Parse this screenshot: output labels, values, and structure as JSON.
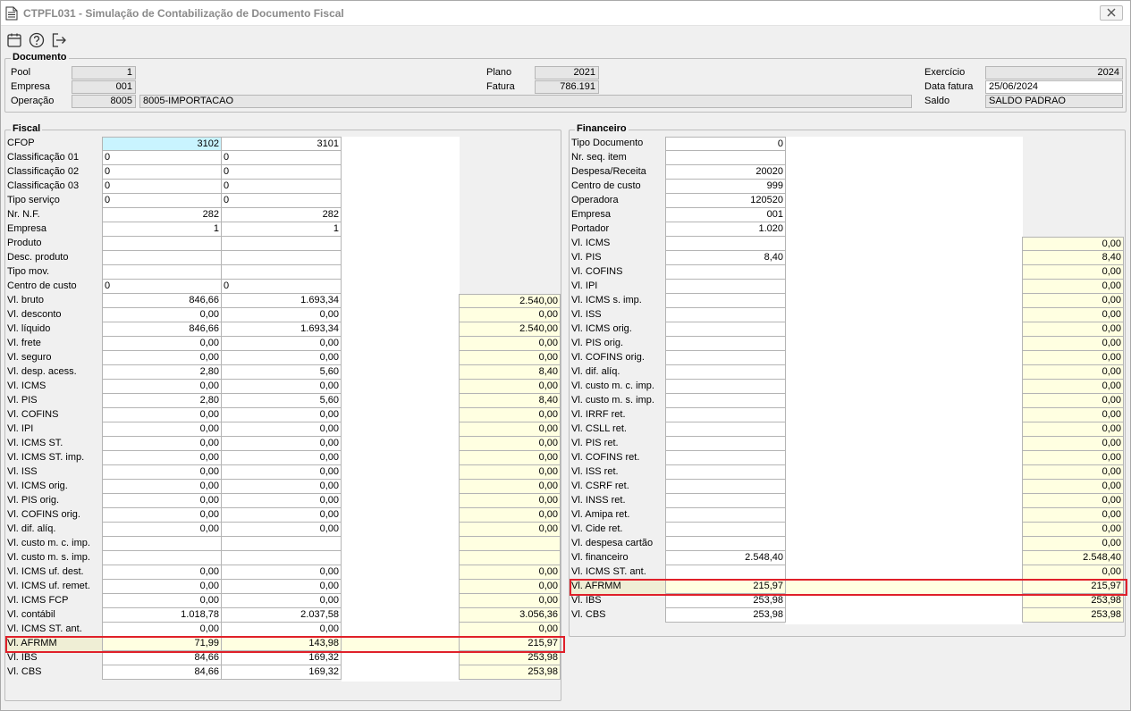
{
  "window": {
    "title": "CTPFL031 - Simulação de Contabilização de Documento Fiscal",
    "icons": {
      "app": "document-icon",
      "close": "close-icon"
    }
  },
  "toolbar": {
    "icons": [
      "calendar-icon",
      "help-icon",
      "exit-icon"
    ]
  },
  "documento": {
    "title": "Documento",
    "pool_label": "Pool",
    "pool": "1",
    "empresa_label": "Empresa",
    "empresa": "001",
    "operacao_label": "Operação",
    "operacao_code": "8005",
    "operacao_desc": "8005-IMPORTACAO",
    "plano_label": "Plano",
    "plano": "2021",
    "fatura_label": "Fatura",
    "fatura": "786.191",
    "exercicio_label": "Exercício",
    "exercicio": "2024",
    "data_fatura_label": "Data fatura",
    "data_fatura": "25/06/2024",
    "saldo_label": "Saldo",
    "saldo": "SALDO PADRAO"
  },
  "fiscal": {
    "title": "Fiscal",
    "rows": [
      {
        "label": "CFOP",
        "c1": "3102",
        "c2": "3101",
        "tot": null
      },
      {
        "label": "Classificação 01",
        "c1": "0",
        "c2": "0",
        "tot": null
      },
      {
        "label": "Classificação 02",
        "c1": "0",
        "c2": "0",
        "tot": null
      },
      {
        "label": "Classificação 03",
        "c1": "0",
        "c2": "0",
        "tot": null
      },
      {
        "label": "Tipo serviço",
        "c1": "0",
        "c2": "0",
        "tot": null
      },
      {
        "label": "Nr. N.F.",
        "c1": "282",
        "c2": "282",
        "tot": null
      },
      {
        "label": "Empresa",
        "c1": "1",
        "c2": "1",
        "tot": null
      },
      {
        "label": "Produto",
        "c1": "",
        "c2": "",
        "tot": null
      },
      {
        "label": "Desc. produto",
        "c1": "",
        "c2": "",
        "tot": null
      },
      {
        "label": "Tipo mov.",
        "c1": "",
        "c2": "",
        "tot": null
      },
      {
        "label": "Centro de custo",
        "c1": "0",
        "c2": "0",
        "tot": null
      },
      {
        "label": "Vl. bruto",
        "c1": "846,66",
        "c2": "1.693,34",
        "tot": "2.540,00"
      },
      {
        "label": "Vl. desconto",
        "c1": "0,00",
        "c2": "0,00",
        "tot": "0,00"
      },
      {
        "label": "Vl. líquido",
        "c1": "846,66",
        "c2": "1.693,34",
        "tot": "2.540,00"
      },
      {
        "label": "Vl. frete",
        "c1": "0,00",
        "c2": "0,00",
        "tot": "0,00"
      },
      {
        "label": "Vl. seguro",
        "c1": "0,00",
        "c2": "0,00",
        "tot": "0,00"
      },
      {
        "label": "Vl. desp. acess.",
        "c1": "2,80",
        "c2": "5,60",
        "tot": "8,40"
      },
      {
        "label": "Vl. ICMS",
        "c1": "0,00",
        "c2": "0,00",
        "tot": "0,00"
      },
      {
        "label": "Vl. PIS",
        "c1": "2,80",
        "c2": "5,60",
        "tot": "8,40"
      },
      {
        "label": "Vl. COFINS",
        "c1": "0,00",
        "c2": "0,00",
        "tot": "0,00"
      },
      {
        "label": "Vl. IPI",
        "c1": "0,00",
        "c2": "0,00",
        "tot": "0,00"
      },
      {
        "label": "Vl. ICMS ST.",
        "c1": "0,00",
        "c2": "0,00",
        "tot": "0,00"
      },
      {
        "label": "Vl. ICMS ST. imp.",
        "c1": "0,00",
        "c2": "0,00",
        "tot": "0,00"
      },
      {
        "label": "Vl. ISS",
        "c1": "0,00",
        "c2": "0,00",
        "tot": "0,00"
      },
      {
        "label": "Vl. ICMS orig.",
        "c1": "0,00",
        "c2": "0,00",
        "tot": "0,00"
      },
      {
        "label": "Vl. PIS orig.",
        "c1": "0,00",
        "c2": "0,00",
        "tot": "0,00"
      },
      {
        "label": "Vl. COFINS orig.",
        "c1": "0,00",
        "c2": "0,00",
        "tot": "0,00"
      },
      {
        "label": "Vl. dif. alíq.",
        "c1": "0,00",
        "c2": "0,00",
        "tot": "0,00"
      },
      {
        "label": "Vl. custo m. c. imp.",
        "c1": "",
        "c2": "",
        "tot": ""
      },
      {
        "label": "Vl. custo m. s. imp.",
        "c1": "",
        "c2": "",
        "tot": ""
      },
      {
        "label": "Vl. ICMS uf. dest.",
        "c1": "0,00",
        "c2": "0,00",
        "tot": "0,00"
      },
      {
        "label": "Vl. ICMS uf. remet.",
        "c1": "0,00",
        "c2": "0,00",
        "tot": "0,00"
      },
      {
        "label": "Vl. ICMS FCP",
        "c1": "0,00",
        "c2": "0,00",
        "tot": "0,00"
      },
      {
        "label": "Vl. contábil",
        "c1": "1.018,78",
        "c2": "2.037,58",
        "tot": "3.056,36"
      },
      {
        "label": "Vl. ICMS ST. ant.",
        "c1": "0,00",
        "c2": "0,00",
        "tot": "0,00"
      },
      {
        "label": "Vl. AFRMM",
        "c1": "71,99",
        "c2": "143,98",
        "tot": "215,97",
        "highlight": true
      },
      {
        "label": "Vl. IBS",
        "c1": "84,66",
        "c2": "169,32",
        "tot": "253,98"
      },
      {
        "label": "Vl. CBS",
        "c1": "84,66",
        "c2": "169,32",
        "tot": "253,98"
      }
    ]
  },
  "financeiro": {
    "title": "Financeiro",
    "rows": [
      {
        "label": "Tipo Documento",
        "v": "0",
        "tot": null
      },
      {
        "label": "Nr. seq. item",
        "v": "",
        "tot": null
      },
      {
        "label": "Despesa/Receita",
        "v": "20020",
        "tot": null
      },
      {
        "label": "Centro de custo",
        "v": "999",
        "tot": null
      },
      {
        "label": "Operadora",
        "v": "120520",
        "tot": null
      },
      {
        "label": "Empresa",
        "v": "001",
        "tot": null
      },
      {
        "label": "Portador",
        "v": "1.020",
        "tot": null
      },
      {
        "label": "Vl. ICMS",
        "v": "",
        "tot": "0,00"
      },
      {
        "label": "Vl. PIS",
        "v": "8,40",
        "tot": "8,40"
      },
      {
        "label": "Vl. COFINS",
        "v": "",
        "tot": "0,00"
      },
      {
        "label": "Vl. IPI",
        "v": "",
        "tot": "0,00"
      },
      {
        "label": "Vl. ICMS s. imp.",
        "v": "",
        "tot": "0,00"
      },
      {
        "label": "Vl. ISS",
        "v": "",
        "tot": "0,00"
      },
      {
        "label": "Vl. ICMS orig.",
        "v": "",
        "tot": "0,00"
      },
      {
        "label": "Vl. PIS orig.",
        "v": "",
        "tot": "0,00"
      },
      {
        "label": "Vl. COFINS orig.",
        "v": "",
        "tot": "0,00"
      },
      {
        "label": "Vl. dif. alíq.",
        "v": "",
        "tot": "0,00"
      },
      {
        "label": "Vl. custo m. c. imp.",
        "v": "",
        "tot": "0,00"
      },
      {
        "label": "Vl. custo m. s. imp.",
        "v": "",
        "tot": "0,00"
      },
      {
        "label": "Vl. IRRF ret.",
        "v": "",
        "tot": "0,00"
      },
      {
        "label": "Vl. CSLL ret.",
        "v": "",
        "tot": "0,00"
      },
      {
        "label": "Vl. PIS ret.",
        "v": "",
        "tot": "0,00"
      },
      {
        "label": "Vl. COFINS ret.",
        "v": "",
        "tot": "0,00"
      },
      {
        "label": "Vl. ISS ret.",
        "v": "",
        "tot": "0,00"
      },
      {
        "label": "Vl. CSRF ret.",
        "v": "",
        "tot": "0,00"
      },
      {
        "label": "Vl. INSS ret.",
        "v": "",
        "tot": "0,00"
      },
      {
        "label": "Vl. Amipa ret.",
        "v": "",
        "tot": "0,00"
      },
      {
        "label": "Vl. Cide ret.",
        "v": "",
        "tot": "0,00"
      },
      {
        "label": "Vl. despesa cartão",
        "v": "",
        "tot": "0,00"
      },
      {
        "label": "Vl. financeiro",
        "v": "2.548,40",
        "tot": "2.548,40"
      },
      {
        "label": "Vl. ICMS ST. ant.",
        "v": "",
        "tot": "0,00"
      },
      {
        "label": "Vl. AFRMM",
        "v": "215,97",
        "tot": "215,97",
        "highlight": true
      },
      {
        "label": "Vl. IBS",
        "v": "253,98",
        "tot": "253,98"
      },
      {
        "label": "Vl. CBS",
        "v": "253,98",
        "tot": "253,98"
      }
    ]
  },
  "colors": {
    "highlight_border": "#e0202a",
    "total_bg": "#ffffe1",
    "selected_cell_bg": "#c9f4ff"
  }
}
